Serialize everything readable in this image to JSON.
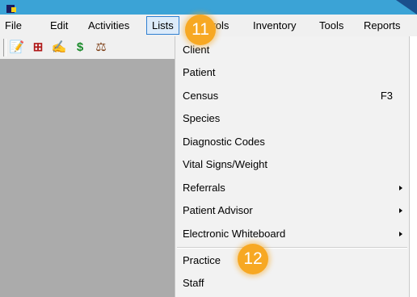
{
  "menubar": {
    "items": [
      "File",
      "Edit",
      "Activities",
      "Lists",
      "Controls",
      "Inventory",
      "Tools",
      "Reports"
    ],
    "active": "Lists"
  },
  "toolbar": {
    "icons": [
      "clipboard-icon",
      "medical-kit-icon",
      "signature-icon",
      "dollar-icon",
      "scale-icon"
    ],
    "glyphs": [
      "📝",
      "⊞",
      "✍",
      "$",
      "⚖"
    ]
  },
  "lists_menu": {
    "items": [
      {
        "label": "Client",
        "shortcut": "",
        "submenu": false
      },
      {
        "label": "Patient",
        "shortcut": "",
        "submenu": false
      },
      {
        "label": "Census",
        "shortcut": "F3",
        "submenu": false
      },
      {
        "label": "Species",
        "shortcut": "",
        "submenu": false
      },
      {
        "label": "Diagnostic Codes",
        "shortcut": "",
        "submenu": false
      },
      {
        "label": "Vital Signs/Weight",
        "shortcut": "",
        "submenu": false
      },
      {
        "label": "Referrals",
        "shortcut": "",
        "submenu": true
      },
      {
        "label": "Patient Advisor",
        "shortcut": "",
        "submenu": true
      },
      {
        "label": "Electronic Whiteboard",
        "shortcut": "",
        "submenu": true
      },
      {
        "label": "Practice",
        "shortcut": "",
        "submenu": false
      },
      {
        "label": "Staff",
        "shortcut": "",
        "submenu": false
      }
    ]
  },
  "callouts": [
    "11",
    "12"
  ],
  "colors": {
    "title_bar": "#3ba3d6",
    "work_area": "#ababab",
    "callout": "#f7a823",
    "menu_highlight": "#dcebfa"
  }
}
